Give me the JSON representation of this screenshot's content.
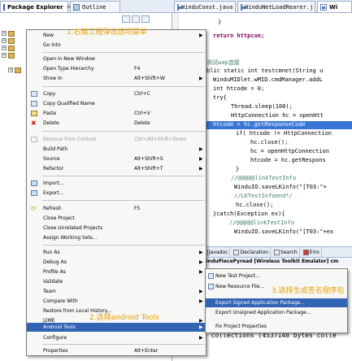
{
  "tabs": {
    "package_explorer": "Package Explorer",
    "outline": "Outline",
    "file1": "WinduConst.java",
    "file2": "WinduNetLoadRearer.j",
    "file3": "Wi"
  },
  "editor": {
    "lines": [
      "}",
      "return httpcon;",
      "测试wap连接",
      "blic static int testcmnet(String u",
      "WinduMIDlet.wMID.cmdManager.addL",
      "int htcode = 0;",
      "try{",
      "Thread.sleep(100);",
      "HttpConnection hc = openHtt",
      "htcode = hc.getResponseCode",
      "if( htcode != HttpConnection",
      "hc.close();",
      "hc = openHttpConnection",
      "htcode = hc.getRespons",
      "}",
      "//@@@@@linkTestInfo",
      "WinduIO.saveLKinfo(\"[T03:\"+",
      "//LKTestInfoend*/",
      "hc.close();",
      "}catch(Exception ex){",
      "//@@@@@linkTestInfo",
      "WinduIO.saveLKinfo(\"[T03:\"+ex"
    ]
  },
  "bottom_view": {
    "tabs": [
      "Javadoc",
      "Declaration",
      "Search",
      "Erro"
    ],
    "subtitle": "WinduPiecePyread [Wireless Toolkit Emulator] cm",
    "console_text": "e collections (4537148 bytes colle"
  },
  "context_menu": {
    "items": [
      {
        "label": "New",
        "key": "",
        "arrow": true
      },
      {
        "label": "Go Into",
        "key": ""
      },
      {
        "label": "Open in New Window",
        "key": ""
      },
      {
        "label": "Open Type Hierarchy",
        "key": "F4"
      },
      {
        "label": "Show In",
        "key": "Alt+Shift+W",
        "arrow": true
      },
      {
        "label": "Copy",
        "key": "Ctrl+C"
      },
      {
        "label": "Copy Qualified Name",
        "key": ""
      },
      {
        "label": "Paste",
        "key": "Ctrl+V"
      },
      {
        "label": "Delete",
        "key": "Delete"
      },
      {
        "label": "Remove from Context",
        "key": "Ctrl+Alt+Shift+Down"
      },
      {
        "label": "Build Path",
        "key": "",
        "arrow": true
      },
      {
        "label": "Source",
        "key": "Alt+Shift+S",
        "arrow": true
      },
      {
        "label": "Refactor",
        "key": "Alt+Shift+T",
        "arrow": true
      },
      {
        "label": "Import...",
        "key": ""
      },
      {
        "label": "Export...",
        "key": ""
      },
      {
        "label": "Refresh",
        "key": "F5"
      },
      {
        "label": "Close Project",
        "key": ""
      },
      {
        "label": "Close Unrelated Projects",
        "key": ""
      },
      {
        "label": "Assign Working Sets...",
        "key": ""
      },
      {
        "label": "Run As",
        "key": "",
        "arrow": true
      },
      {
        "label": "Debug As",
        "key": "",
        "arrow": true
      },
      {
        "label": "Profile As",
        "key": "",
        "arrow": true
      },
      {
        "label": "Validate",
        "key": ""
      },
      {
        "label": "Team",
        "key": "",
        "arrow": true
      },
      {
        "label": "Compare With",
        "key": "",
        "arrow": true
      },
      {
        "label": "Restore from Local History...",
        "key": ""
      },
      {
        "label": "J2ME",
        "key": "",
        "arrow": true
      },
      {
        "label": "Android Tools",
        "key": "",
        "arrow": true
      },
      {
        "label": "Configure",
        "key": "",
        "arrow": true
      },
      {
        "label": "Properties",
        "key": "Alt+Enter"
      }
    ]
  },
  "submenu": {
    "items": [
      "New Test Project...",
      "New Resource File...",
      "Export Signed Application Package...",
      "Export Unsigned Application Package...",
      "Fix Project Properties"
    ]
  },
  "annotations": {
    "step1": "1.右键工程弹出选项菜单",
    "step2": "2.选择android Tools",
    "step3": "3.选择生成签名程序包"
  },
  "colors": {
    "selection": "#3264b4",
    "annotation": "#e8a000",
    "tab_bg": "#e6ecf5"
  }
}
